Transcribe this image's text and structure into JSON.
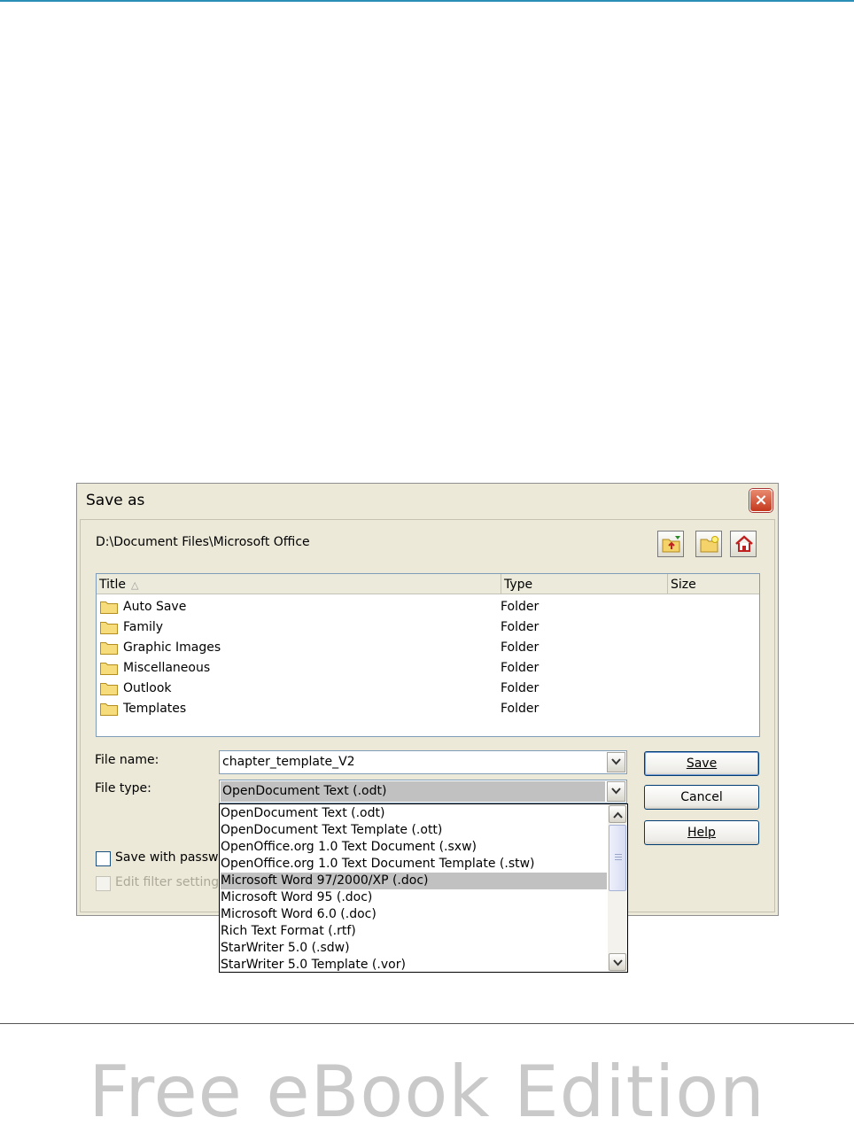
{
  "dialog": {
    "title": "Save as",
    "close_glyph": "×",
    "path": "D:\\Document Files\\Microsoft Office",
    "toolbar_icons": [
      "folder-up-icon",
      "new-folder-icon",
      "home-icon"
    ]
  },
  "filelist": {
    "columns": {
      "title": "Title",
      "sort_glyph": "△",
      "type": "Type",
      "size": "Size"
    },
    "rows": [
      {
        "name": "Auto Save",
        "type": "Folder"
      },
      {
        "name": "Family",
        "type": "Folder"
      },
      {
        "name": "Graphic Images",
        "type": "Folder"
      },
      {
        "name": "Miscellaneous",
        "type": "Folder"
      },
      {
        "name": "Outlook",
        "type": "Folder"
      },
      {
        "name": "Templates",
        "type": "Folder"
      }
    ]
  },
  "form": {
    "file_name_label": "File name:",
    "file_name_value": "chapter_template_V2",
    "file_type_label": "File type:",
    "file_type_value": "OpenDocument Text (.odt)",
    "save_label": "Save",
    "cancel_label": "Cancel",
    "help_label": "Help",
    "save_with_password_label": "Save with passwo",
    "edit_filter_settings_label": "Edit filter settings"
  },
  "file_type_options": [
    "OpenDocument Text (.odt)",
    "OpenDocument Text Template (.ott)",
    "OpenOffice.org 1.0 Text Document (.sxw)",
    "OpenOffice.org 1.0 Text Document Template (.stw)",
    "Microsoft Word 97/2000/XP (.doc)",
    "Microsoft Word 95 (.doc)",
    "Microsoft Word 6.0 (.doc)",
    "Rich Text Format (.rtf)",
    "StarWriter 5.0 (.sdw)",
    "StarWriter 5.0 Template (.vor)"
  ],
  "highlighted_option": "Microsoft Word 97/2000/XP (.doc)",
  "watermark": "Free eBook Edition",
  "colors": {
    "accent_rule": "#2a8fb6",
    "close_button": "#c5381c",
    "highlight": "#c1c1c1"
  }
}
